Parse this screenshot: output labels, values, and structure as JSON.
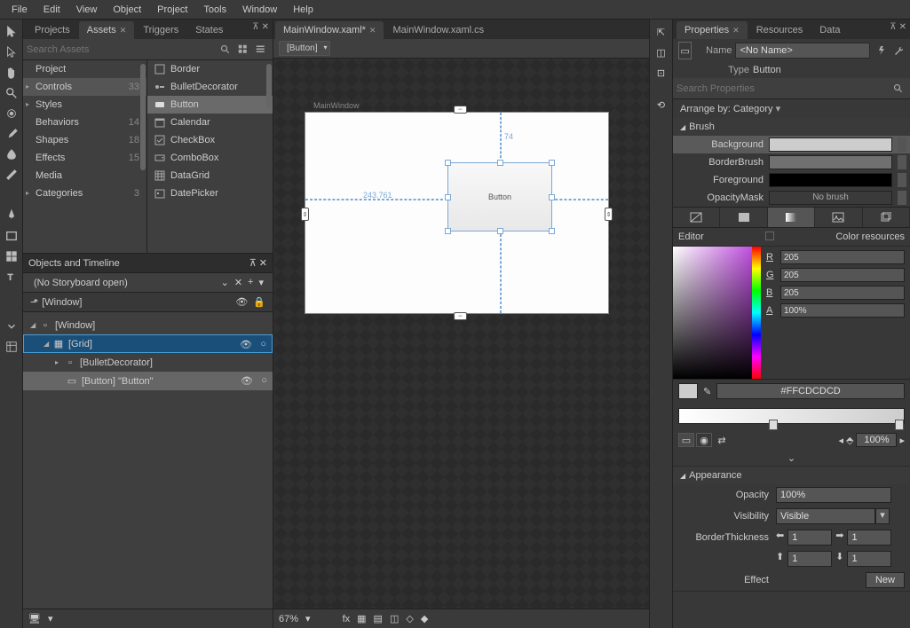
{
  "menu": [
    "File",
    "Edit",
    "View",
    "Object",
    "Project",
    "Tools",
    "Window",
    "Help"
  ],
  "leftTabs": {
    "projects": "Projects",
    "assets": "Assets",
    "triggers": "Triggers",
    "states": "States"
  },
  "searchAssets": "Search Assets",
  "categories": [
    {
      "name": "Project",
      "tri": "",
      "cnt": ""
    },
    {
      "name": "Controls",
      "tri": "▸",
      "cnt": "33"
    },
    {
      "name": "Styles",
      "tri": "▸",
      "cnt": ""
    },
    {
      "name": "Behaviors",
      "tri": "",
      "cnt": "14"
    },
    {
      "name": "Shapes",
      "tri": "",
      "cnt": "18"
    },
    {
      "name": "Effects",
      "tri": "",
      "cnt": "15"
    },
    {
      "name": "Media",
      "tri": "",
      "cnt": ""
    },
    {
      "name": "Categories",
      "tri": "▸",
      "cnt": "3"
    }
  ],
  "assets": [
    "Border",
    "BulletDecorator",
    "Button",
    "Calendar",
    "CheckBox",
    "ComboBox",
    "DataGrid",
    "DatePicker"
  ],
  "timeline": {
    "title": "Objects and Timeline",
    "nostory": "(No Storyboard open)",
    "root": "[Window]"
  },
  "tree": [
    {
      "d": 0,
      "t": "[Window]",
      "tri": "◢"
    },
    {
      "d": 1,
      "t": "[Grid]",
      "tri": "◢",
      "sel": true
    },
    {
      "d": 2,
      "t": "[BulletDecorator]",
      "tri": "▸"
    },
    {
      "d": 2,
      "t": "[Button] \"Button\"",
      "tri": "",
      "hl": true
    }
  ],
  "docs": {
    "a": "MainWindow.xaml*",
    "b": "MainWindow.xaml.cs"
  },
  "breadcrumb": "[Button]",
  "designer": {
    "winlabel": "MainWindow",
    "btn": "Button",
    "dim": "243.761",
    "dimTop": "74"
  },
  "zoom": "67%",
  "rightTabs": {
    "props": "Properties",
    "res": "Resources",
    "data": "Data"
  },
  "props": {
    "nameLbl": "Name",
    "nameVal": "<No Name>",
    "typeLbl": "Type",
    "typeVal": "Button"
  },
  "searchProps": "Search Properties",
  "arrange": "Arrange by: Category",
  "brush": {
    "title": "Brush",
    "bg": "Background",
    "bb": "BorderBrush",
    "fg": "Foreground",
    "om": "OpacityMask",
    "nobrush": "No brush"
  },
  "editor": {
    "lbl": "Editor",
    "res": "Color resources",
    "r": "205",
    "g": "205",
    "b": "205",
    "a": "100%",
    "hex": "#FFCDCDCD",
    "pct": "100%"
  },
  "appearance": {
    "title": "Appearance",
    "op": "Opacity",
    "opv": "100%",
    "vis": "Visibility",
    "visv": "Visible",
    "bt": "BorderThickness",
    "t1": "1",
    "eff": "Effect",
    "new": "New"
  }
}
